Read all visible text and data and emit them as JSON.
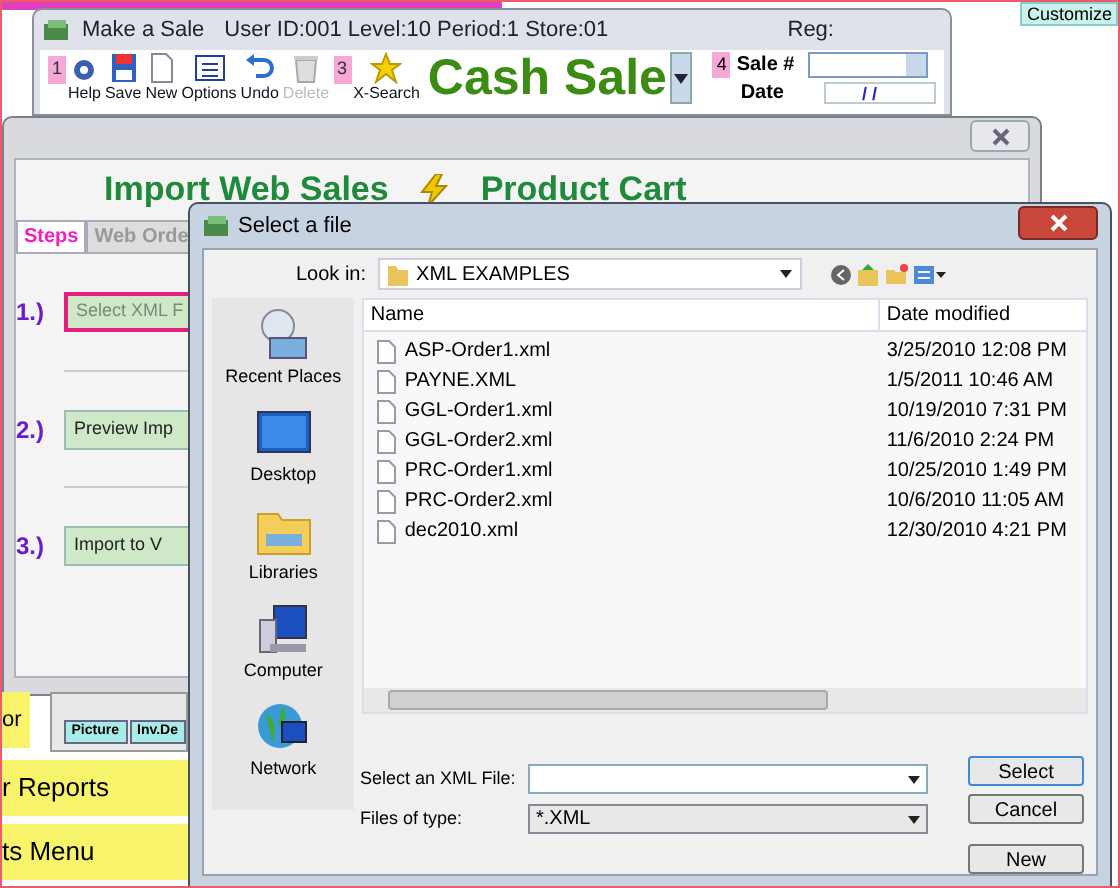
{
  "customize_button": "Customize",
  "sale_window": {
    "title": "Make a Sale",
    "info": "User ID:001 Level:10 Period:1 Store:01",
    "reg_label": "Reg:",
    "toolbar": [
      {
        "kind": "help",
        "label": "Help",
        "badge": "1",
        "disabled": false
      },
      {
        "kind": "save",
        "label": "Save",
        "disabled": false
      },
      {
        "kind": "new",
        "label": "New",
        "disabled": false
      },
      {
        "kind": "options",
        "label": "Options",
        "disabled": false
      },
      {
        "kind": "undo",
        "label": "Undo",
        "disabled": false
      },
      {
        "kind": "delete",
        "label": "Delete",
        "disabled": true
      },
      {
        "kind": "search",
        "label": "X-Search",
        "badge": "3",
        "disabled": false
      }
    ],
    "sale_type": "Cash Sale",
    "sale_number": {
      "badge": "4",
      "label": "Sale #"
    },
    "date": {
      "label": "Date",
      "value": "/ /"
    }
  },
  "import_window": {
    "title_left": "Import Web Sales",
    "title_right": "Product Cart",
    "tabs": [
      {
        "label": "Steps",
        "selected": true
      },
      {
        "label": "Web Orde",
        "selected": false
      }
    ],
    "steps": [
      {
        "number": "1.)",
        "button": "Select XML F",
        "highlighted": true
      },
      {
        "number": "2.)",
        "button": "Preview Imp",
        "highlighted": false
      },
      {
        "number": "3.)",
        "button": "Import to V",
        "highlighted": false
      }
    ]
  },
  "main_menu": {
    "panel_tabs": [
      "Picture",
      "Inv.De"
    ],
    "items": [
      "or",
      "r Reports",
      "ts Menu"
    ]
  },
  "dialog": {
    "title": "Select a file",
    "look_in_label": "Look in:",
    "look_in_value": "XML EXAMPLES",
    "places": [
      {
        "kind": "recent",
        "label": "Recent Places"
      },
      {
        "kind": "desktop",
        "label": "Desktop"
      },
      {
        "kind": "libraries",
        "label": "Libraries"
      },
      {
        "kind": "computer",
        "label": "Computer"
      },
      {
        "kind": "network",
        "label": "Network"
      }
    ],
    "columns": [
      "Name",
      "Date modified"
    ],
    "files": [
      {
        "name": "ASP-Order1.xml",
        "date": "3/25/2010 12:08 PM"
      },
      {
        "name": "PAYNE.XML",
        "date": "1/5/2011 10:46 AM"
      },
      {
        "name": "GGL-Order1.xml",
        "date": "10/19/2010 7:31 PM"
      },
      {
        "name": "GGL-Order2.xml",
        "date": "11/6/2010 2:24 PM"
      },
      {
        "name": "PRC-Order1.xml",
        "date": "10/25/2010 1:49 PM"
      },
      {
        "name": "PRC-Order2.xml",
        "date": "10/6/2010 11:05 AM"
      },
      {
        "name": "dec2010.xml",
        "date": "12/30/2010 4:21 PM"
      }
    ],
    "file_name_label": "Select an XML File:",
    "files_of_type_label": "Files of type:",
    "files_of_type_value": "*.XML",
    "buttons": [
      "Select",
      "Cancel",
      "New"
    ]
  }
}
